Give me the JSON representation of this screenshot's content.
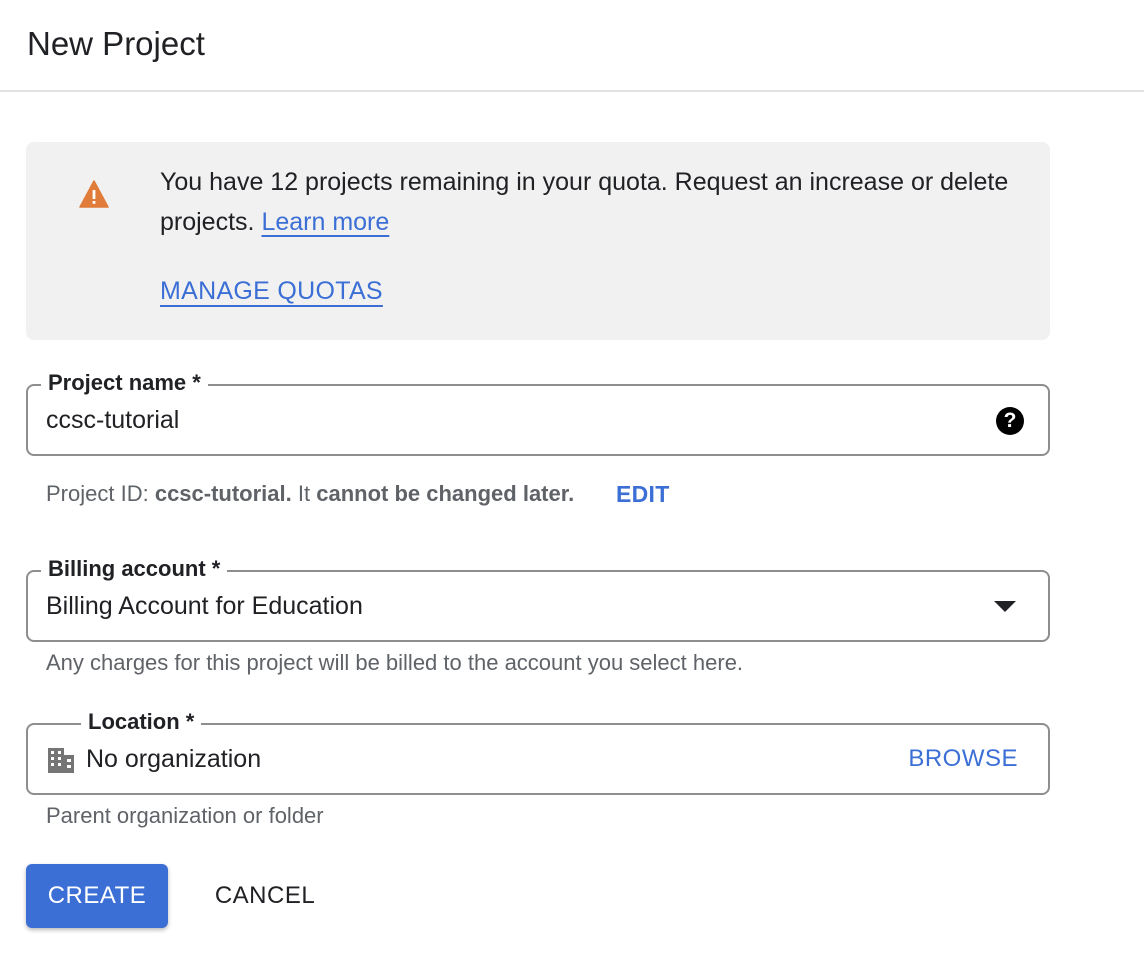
{
  "header": {
    "title": "New Project"
  },
  "quota_banner": {
    "icon": "warning-icon",
    "message": "You have 12 projects remaining in your quota. Request an increase or delete projects.",
    "learn_more_label": "Learn more",
    "manage_quotas_label": "MANAGE QUOTAS"
  },
  "project_name": {
    "label": "Project name *",
    "value": "ccsc-tutorial",
    "help_icon": "help-circle-icon",
    "help_glyph": "?"
  },
  "project_id": {
    "prefix": "Project ID:",
    "id": "ccsc-tutorial.",
    "middle": "It",
    "suffix": "cannot be changed later.",
    "edit_label": "EDIT"
  },
  "billing_account": {
    "label": "Billing account *",
    "value": "Billing Account for Education",
    "helper": "Any charges for this project will be billed to the account you select here."
  },
  "location": {
    "label": "Location *",
    "value": "No organization",
    "icon": "building-icon",
    "browse_label": "BROWSE",
    "helper": "Parent organization or folder"
  },
  "actions": {
    "create_label": "CREATE",
    "cancel_label": "CANCEL"
  },
  "colors": {
    "accent": "#3b6fd6",
    "warning": "#e07b39",
    "banner_bg": "#f1f1f1"
  }
}
